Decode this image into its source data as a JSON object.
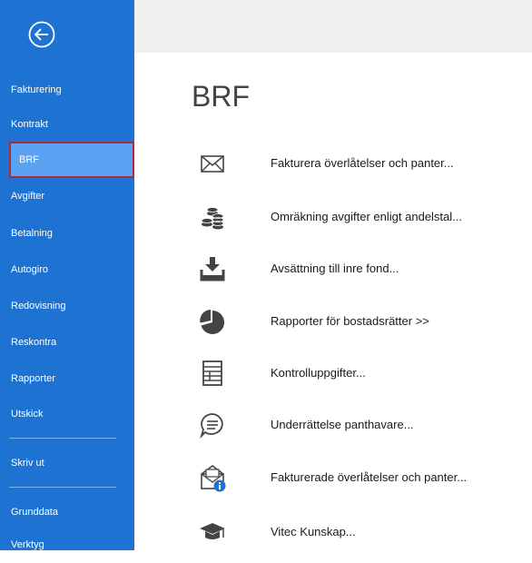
{
  "sidebar": {
    "items": [
      {
        "label": "Fakturering"
      },
      {
        "label": "Kontrakt"
      },
      {
        "label": "BRF"
      },
      {
        "label": "Avgifter"
      },
      {
        "label": "Betalning"
      },
      {
        "label": "Autogiro"
      },
      {
        "label": "Redovisning"
      },
      {
        "label": "Reskontra"
      },
      {
        "label": "Rapporter"
      },
      {
        "label": "Utskick"
      },
      {
        "label": "Skriv ut"
      },
      {
        "label": "Grunddata"
      },
      {
        "label": "Verktyg"
      }
    ],
    "selected_index": 2,
    "colors": {
      "background": "#1e73d2",
      "selected": "#5ca2f2",
      "selected_border": "#a82b3e"
    }
  },
  "main": {
    "title": "BRF",
    "commands": [
      {
        "label": "Fakturera överlåtelser och panter...",
        "icon": "envelope-icon"
      },
      {
        "label": "Omräkning avgifter enligt andelstal...",
        "icon": "coins-icon"
      },
      {
        "label": "Avsättning till inre fond...",
        "icon": "download-tray-icon"
      },
      {
        "label": "Rapporter för bostadsrätter >>",
        "icon": "pie-chart-icon"
      },
      {
        "label": "Kontrolluppgifter...",
        "icon": "form-icon"
      },
      {
        "label": "Underrättelse panthavare...",
        "icon": "speech-bubble-icon"
      },
      {
        "label": "Fakturerade överlåtelser och panter...",
        "icon": "envelope-info-icon"
      },
      {
        "label": "Vitec Kunskap...",
        "icon": "graduation-cap-icon"
      }
    ]
  }
}
